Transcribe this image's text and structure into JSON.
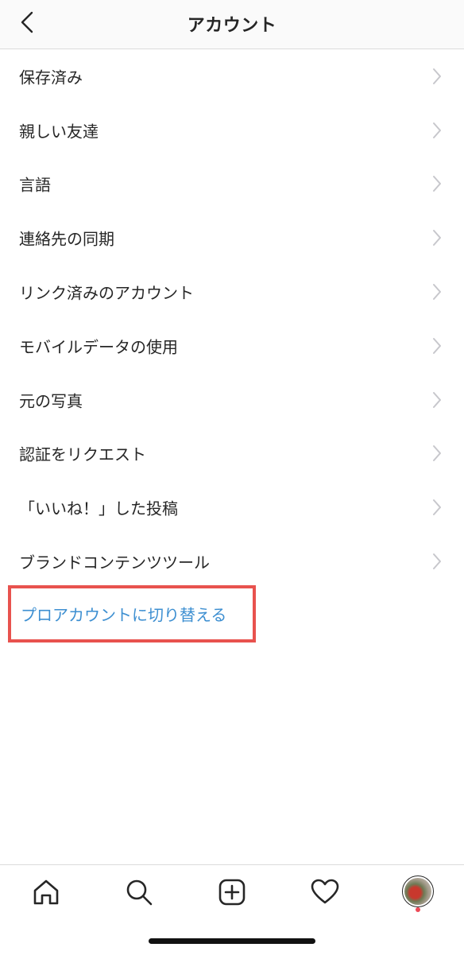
{
  "header": {
    "title": "アカウント",
    "back_icon": "chevron-left-icon"
  },
  "menu": {
    "items": [
      {
        "label": "保存済み"
      },
      {
        "label": "親しい友達"
      },
      {
        "label": "言語"
      },
      {
        "label": "連絡先の同期"
      },
      {
        "label": "リンク済みのアカウント"
      },
      {
        "label": "モバイルデータの使用"
      },
      {
        "label": "元の写真"
      },
      {
        "label": "認証をリクエスト"
      },
      {
        "label": "「いいね！」した投稿"
      },
      {
        "label": "ブランドコンテンツツール"
      }
    ],
    "chevron_icon": "chevron-right-icon"
  },
  "pro_link": {
    "label": "プロアカウントに切り替える",
    "color": "#3d8fd1",
    "highlight_color": "#e8524e"
  },
  "tabbar": {
    "icons": [
      "home-icon",
      "search-icon",
      "add-post-icon",
      "activity-heart-icon",
      "profile-avatar"
    ],
    "notification_color": "#ed4956"
  }
}
